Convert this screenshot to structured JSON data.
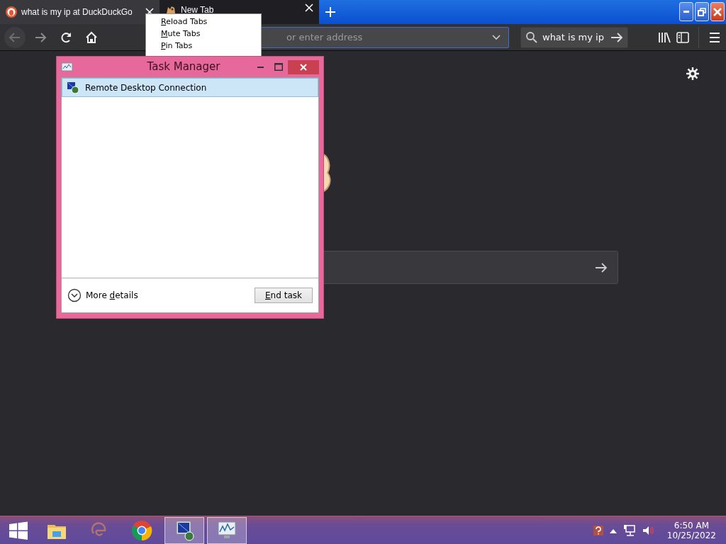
{
  "browser": {
    "tabs": [
      {
        "title": "what is my ip at DuckDuckGo",
        "selected": true
      },
      {
        "title": "New Tab",
        "selected": false
      }
    ],
    "address_bar": {
      "placeholder": "or enter address"
    },
    "search_bar": {
      "value": "what is my ip"
    }
  },
  "context_menu": {
    "items": [
      {
        "label": "Reload Tabs"
      },
      {
        "label": "Mute Tabs"
      },
      {
        "label": "Pin Tabs"
      }
    ]
  },
  "task_manager": {
    "title": "Task Manager",
    "processes": [
      {
        "name": "Remote Desktop Connection",
        "selected": true
      }
    ],
    "more_details": {
      "label": "More details"
    },
    "end_task": {
      "label": "End task"
    }
  },
  "taskbar": {
    "apps": [
      {
        "kind": "folder",
        "active": false
      },
      {
        "kind": "ie",
        "active": false
      },
      {
        "kind": "chrome",
        "active": false
      },
      {
        "kind": "rdp",
        "active": true
      },
      {
        "kind": "taskmgr",
        "active": true
      }
    ],
    "clock": {
      "time": "6:50 AM",
      "date": "10/25/2022"
    }
  }
}
